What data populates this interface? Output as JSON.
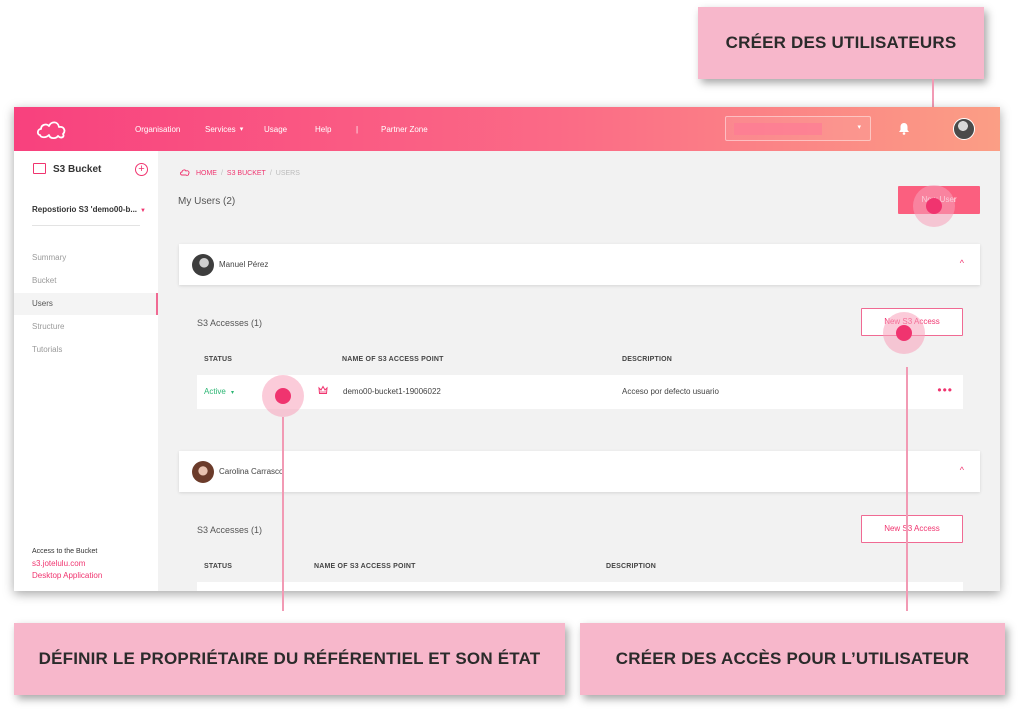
{
  "callouts": {
    "create_users": "CRÉER DES UTILISATEURS",
    "define_owner": "DÉFINIR LE PROPRIÉTAIRE DU RÉFÉRENTIEL ET SON ÉTAT",
    "create_access": "CRÉER DES ACCÈS POUR L’UTILISATEUR"
  },
  "topbar": {
    "nav": [
      "Organisation",
      "Services",
      "Usage",
      "Help",
      "|",
      "Partner Zone"
    ],
    "services_caret": "▾",
    "select_caret": "▾"
  },
  "sidebar": {
    "title": "S3 Bucket",
    "add": "+",
    "repo": "Repostiorio S3 'demo00-b...",
    "repo_caret": "▼",
    "items": [
      {
        "label": "Summary",
        "active": false
      },
      {
        "label": "Bucket",
        "active": false
      },
      {
        "label": "Users",
        "active": true
      },
      {
        "label": "Structure",
        "active": false
      },
      {
        "label": "Tutorials",
        "active": false
      }
    ],
    "footer": {
      "label": "Access to the Bucket",
      "url": "s3.jotelulu.com",
      "app": "Desktop Application"
    }
  },
  "main": {
    "breadcrumb": {
      "home": "HOME",
      "bucket": "S3 BUCKET",
      "current": "USERS",
      "sep": "/"
    },
    "title": "My Users (2)",
    "new_user": "New User",
    "users": [
      {
        "name": "Manuel Pérez",
        "accesses_title": "S3 Accesses (1)",
        "new_access": "New S3 Access",
        "headers": [
          "STATUS",
          "NAME OF S3 ACCESS POINT",
          "DESCRIPTION"
        ],
        "rows": [
          {
            "status": "Active",
            "status_caret": "▾",
            "name": "demo00-bucket1-19006022",
            "description": "Acceso por defecto usuario",
            "more": "•••"
          }
        ]
      },
      {
        "name": "Carolina Carrasco",
        "accesses_title": "S3 Accesses (1)",
        "new_access": "New S3 Access",
        "headers": [
          "STATUS",
          "NAME OF S3 ACCESS POINT",
          "DESCRIPTION"
        ]
      }
    ],
    "chevron": "^"
  },
  "colors": {
    "accent": "#f0346f",
    "active_status": "#2bb673",
    "callout_bg": "#f7b7cb"
  }
}
